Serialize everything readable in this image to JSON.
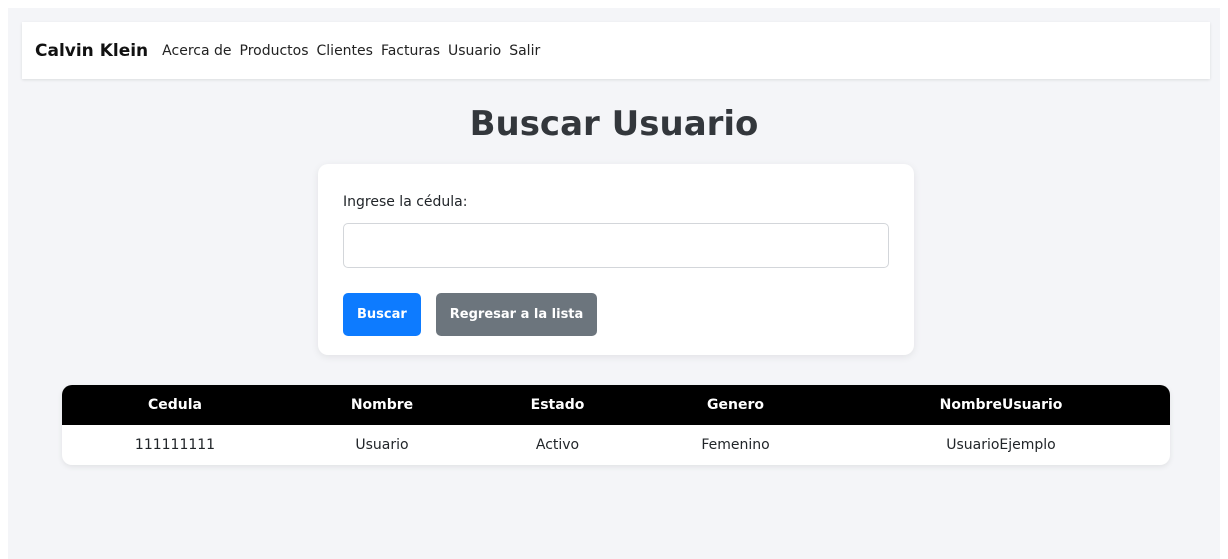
{
  "navbar": {
    "brand": "Calvin Klein",
    "links": [
      "Acerca de",
      "Productos",
      "Clientes",
      "Facturas",
      "Usuario",
      "Salir"
    ]
  },
  "title": "Buscar Usuario",
  "search": {
    "label": "Ingrese la cédula:",
    "value": "",
    "search_button": "Buscar",
    "back_button": "Regresar a la lista"
  },
  "table": {
    "headers": [
      "Cedula",
      "Nombre",
      "Estado",
      "Genero",
      "NombreUsuario"
    ],
    "rows": [
      [
        "111111111",
        "Usuario",
        "Activo",
        "Femenino",
        "UsuarioEjemplo"
      ]
    ]
  },
  "colors": {
    "primary": "#0d7bff",
    "secondary": "#6c757d",
    "table_header": "#000000",
    "background": "#f4f5f8"
  }
}
